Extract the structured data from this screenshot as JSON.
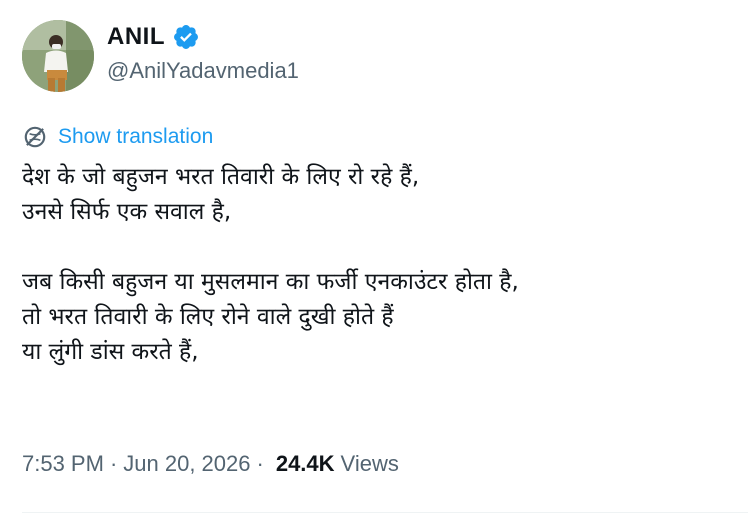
{
  "author": {
    "display_name": "ANIL",
    "handle": "@AnilYadavmedia1",
    "verified": true,
    "verified_color": "#1d9bf0"
  },
  "translate": {
    "label": "Show translation",
    "icon": "globe-icon"
  },
  "tweet": {
    "lines": [
      "देश के जो बहुजन भरत तिवारी के लिए रो रहे हैं,",
      "उनसे सिर्फ एक सवाल है,",
      "",
      "जब किसी बहुजन या मुसलमान का फर्जी एनकाउंटर होता है,",
      "तो भरत तिवारी के लिए रोने वाले दुखी होते हैं",
      "या लुंगी डांस करते हैं,"
    ]
  },
  "meta": {
    "time": "7:53 PM",
    "date": "Jun 20, 2026",
    "separator": "·",
    "views_count": "24.4K",
    "views_label": "Views"
  },
  "colors": {
    "link": "#1d9bf0",
    "secondary_text": "#536471",
    "primary_text": "#0f1419"
  }
}
